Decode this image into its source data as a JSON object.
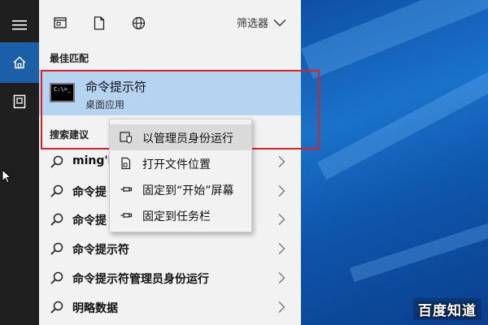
{
  "panel": {
    "filter_label": "筛选器",
    "best_match_heading": "最佳匹配",
    "best_match": {
      "title": "命令提示符",
      "subtitle": "桌面应用",
      "icon_text": "C:\\>_"
    },
    "suggestions_heading": "搜索建议",
    "suggestions": [
      {
        "label": "ming'l"
      },
      {
        "label": "命令提"
      },
      {
        "label": "命令提"
      },
      {
        "label": "命令提示符"
      },
      {
        "label": "命令提示符管理员身份运行"
      },
      {
        "label": "明略数据"
      }
    ]
  },
  "context_menu": {
    "items": [
      {
        "label": "以管理员身份运行",
        "icon": "shield-icon"
      },
      {
        "label": "打开文件位置",
        "icon": "file-icon"
      },
      {
        "label": "固定到“开始”屏幕",
        "icon": "pin-icon"
      },
      {
        "label": "固定到任务栏",
        "icon": "pin-icon"
      }
    ]
  },
  "watermark": "百度知道",
  "colors": {
    "rail_bg": "#1f1f1f",
    "rail_active": "#1b5fa8",
    "panel_bg": "#f2f2f2",
    "best_match_bg": "#b5d4f1",
    "highlight_border": "#e02020",
    "desktop_blue": "#1565c0"
  }
}
